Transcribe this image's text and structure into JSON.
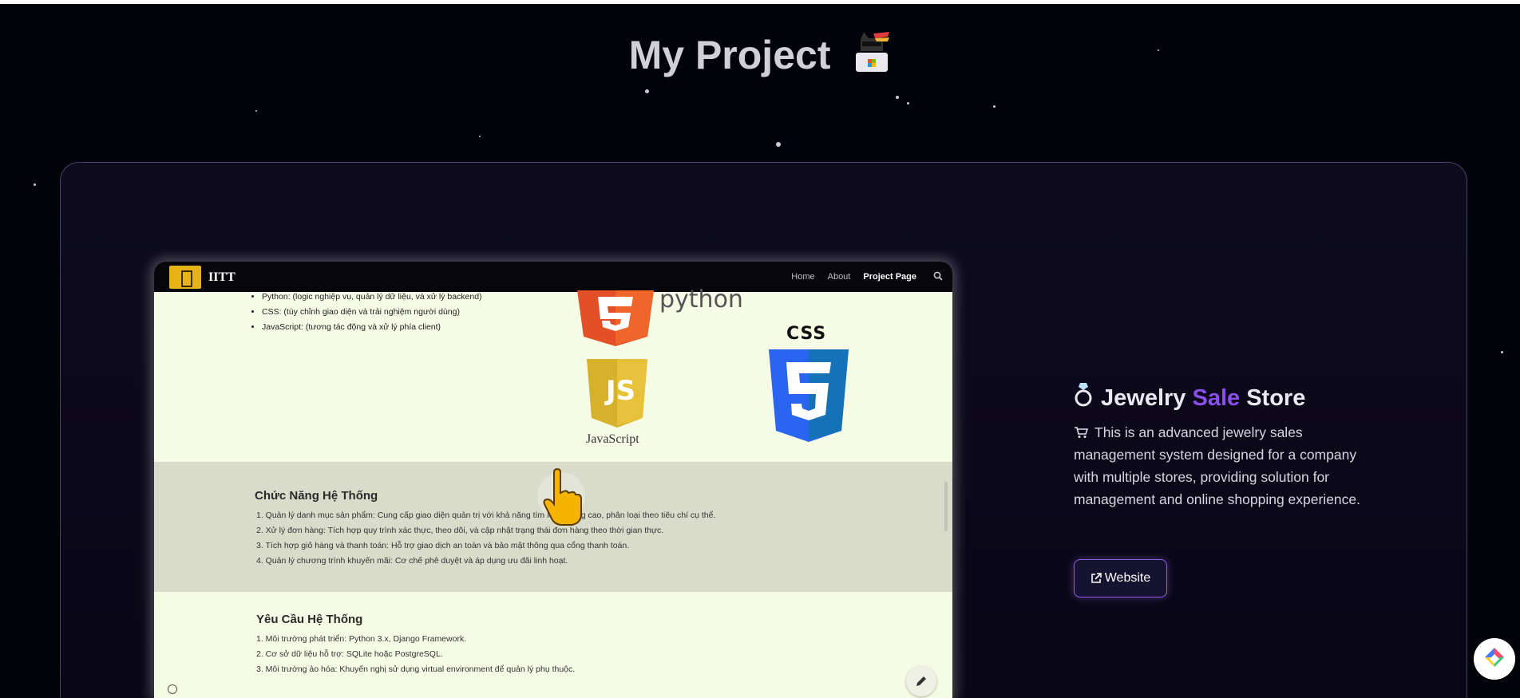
{
  "header": {
    "title": "My Project"
  },
  "project": {
    "title_part1": "Jewelry",
    "title_highlight": "Sale",
    "title_part2": "Store",
    "description": "This is an advanced jewelry sales management system designed for a company with multiple stores, providing solution for management and online shopping experience.",
    "button_label": "Website"
  },
  "preview": {
    "brand": "IITT",
    "nav": [
      "Home",
      "About",
      "Project Page"
    ],
    "tech_list": [
      "Python: (logic nghiệp vụ, quản lý dữ liệu, và xử lý backend)",
      "CSS: (tùy chỉnh giao diện và trải nghiệm người dùng)",
      "JavaScript: (tương tác động và xử lý phía client)"
    ],
    "logos": {
      "python": "python",
      "css": "CSS",
      "js": "JS",
      "javascript": "JavaScript"
    },
    "features": {
      "title": "Chức Năng Hệ Thống",
      "items": [
        "1. Quản lý danh mục sản phẩm: Cung cấp giao diện quản trị với khả năng tìm kiếm nâng cao, phân loại theo tiêu chí cụ thể.",
        "2. Xử lý đơn hàng: Tích hợp quy trình xác thực, theo dõi, và cập nhật trạng thái đơn hàng theo thời gian thực.",
        "3. Tích hợp giỏ hàng và thanh toán: Hỗ trợ giao dịch an toàn và bảo mật thông qua cổng thanh toán.",
        "4. Quản lý chương trình khuyến mãi: Cơ chế phê duyệt và áp dụng ưu đãi linh hoạt."
      ]
    },
    "requirements": {
      "title": "Yêu Cầu Hệ Thống",
      "items": [
        "1. Môi trường phát triển: Python 3.x, Django Framework.",
        "2. Cơ sở dữ liệu hỗ trợ: SQLite hoặc PostgreSQL.",
        "3. Môi trường ảo hóa: Khuyến nghị sử dụng virtual environment để quản lý phụ thuộc."
      ]
    }
  },
  "icons": [
    "hacker-cat-emoji-icon",
    "ring-icon",
    "shopping-cart-icon",
    "external-link-icon",
    "pointing-hand-cursor-icon",
    "search-icon",
    "pencil-icon",
    "info-icon",
    "color-diamond-icon"
  ],
  "colors": {
    "background": "#02020a",
    "accent": "#8a4fe8",
    "card": "#0c0a1c",
    "preview_bg": "#f6fbe6"
  }
}
